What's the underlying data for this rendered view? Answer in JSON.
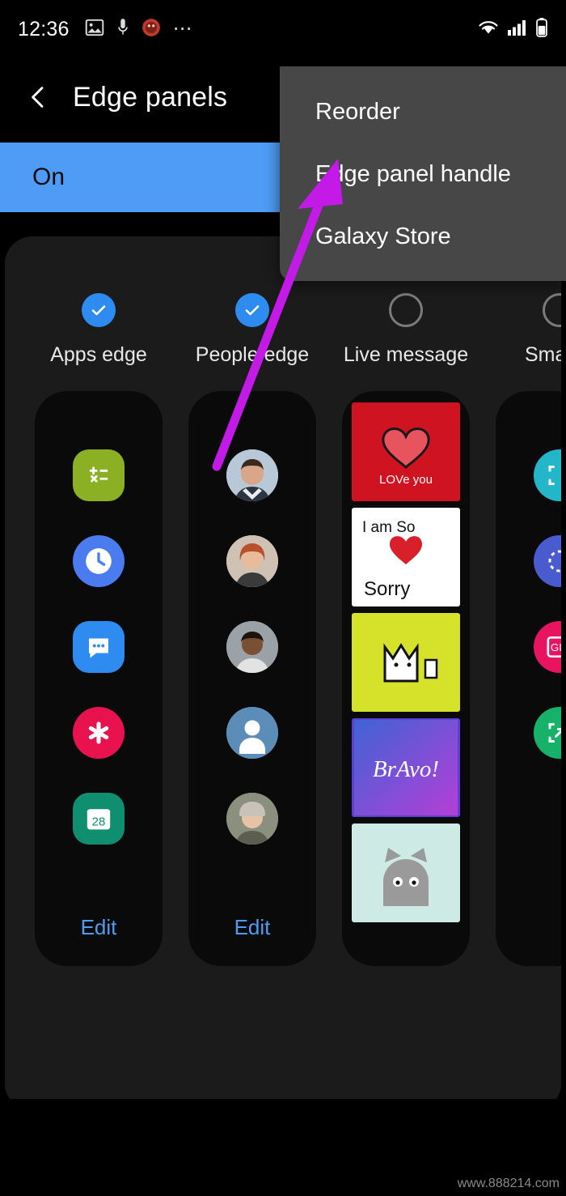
{
  "status_bar": {
    "time": "12:36",
    "left_icons": [
      "image-icon",
      "microphone-icon",
      "app-badge-icon",
      "more-dots-icon"
    ],
    "right_icons": [
      "wifi-icon",
      "signal-icon",
      "battery-icon"
    ]
  },
  "header": {
    "back_icon": "back-chevron-icon",
    "title": "Edge panels",
    "toggle_label": "On"
  },
  "menu": {
    "items": [
      {
        "label": "Reorder"
      },
      {
        "label": "Edge panel handle"
      },
      {
        "label": "Galaxy Store"
      }
    ]
  },
  "panels": [
    {
      "label": "Apps edge",
      "checked": true,
      "edit_label": "Edit",
      "icons": [
        {
          "name": "calculator-icon",
          "glyph": "÷",
          "color": "#8bb024"
        },
        {
          "name": "clock-icon",
          "glyph": "◴",
          "color": "#4a7cf0"
        },
        {
          "name": "messages-icon",
          "glyph": "•••",
          "color": "#2e8bf0"
        },
        {
          "name": "gallery-icon",
          "glyph": "✻",
          "color": "#e8134e"
        },
        {
          "name": "calendar-icon",
          "glyph": "28",
          "color": "#0f8f6f"
        }
      ]
    },
    {
      "label": "People edge",
      "checked": true,
      "edit_label": "Edit",
      "contacts": [
        {
          "name": "contact-avatar-1",
          "skin": "#d9a68a",
          "hair": "#3a2a20",
          "bg": "#b7c7d8"
        },
        {
          "name": "contact-avatar-2",
          "skin": "#e8bb9c",
          "hair": "#b8502a",
          "bg": "#cfc2b4"
        },
        {
          "name": "contact-avatar-3",
          "skin": "#7a5034",
          "hair": "#1d130d",
          "bg": "#9aa2a8"
        },
        {
          "name": "contact-avatar-placeholder",
          "skin": "#ffffff",
          "hair": "#ffffff",
          "bg": "#5b8db8"
        },
        {
          "name": "contact-avatar-5",
          "skin": "#e6c2a6",
          "hair": "#c9c2b8",
          "bg": "#8a8f7e"
        }
      ]
    },
    {
      "label": "Live message",
      "checked": false,
      "cards": [
        {
          "name": "live-message-love-you",
          "text": "LOVe you",
          "bg": "#cf1320",
          "fg": "#ffffff"
        },
        {
          "name": "live-message-sorry",
          "text": "I am So Sorry",
          "bg": "#ffffff",
          "fg": "#111111"
        },
        {
          "name": "live-message-cat",
          "text": "",
          "bg": "#d6e22a",
          "fg": "#111111"
        },
        {
          "name": "live-message-bravo",
          "text": "BrAvo!",
          "bg": "#5b3fd6",
          "fg": "#ffffff"
        },
        {
          "name": "live-message-wolf",
          "text": "",
          "bg": "#cdeae4",
          "fg": "#777777"
        }
      ]
    },
    {
      "label": "Smart s",
      "checked": false,
      "icons": [
        {
          "name": "rectangle-select-icon",
          "glyph": "⬚",
          "color": "#23b6c8"
        },
        {
          "name": "oval-select-icon",
          "glyph": "◌",
          "color": "#4a5bd0"
        },
        {
          "name": "gif-select-icon",
          "glyph": "GIF",
          "color": "#e8145f"
        },
        {
          "name": "pin-to-screen-icon",
          "glyph": "⤢",
          "color": "#17b26a"
        }
      ]
    }
  ],
  "annotation": {
    "arrow_color": "#c41ae8",
    "points_to": "Edge panel handle"
  },
  "watermark": "www.888214.com"
}
